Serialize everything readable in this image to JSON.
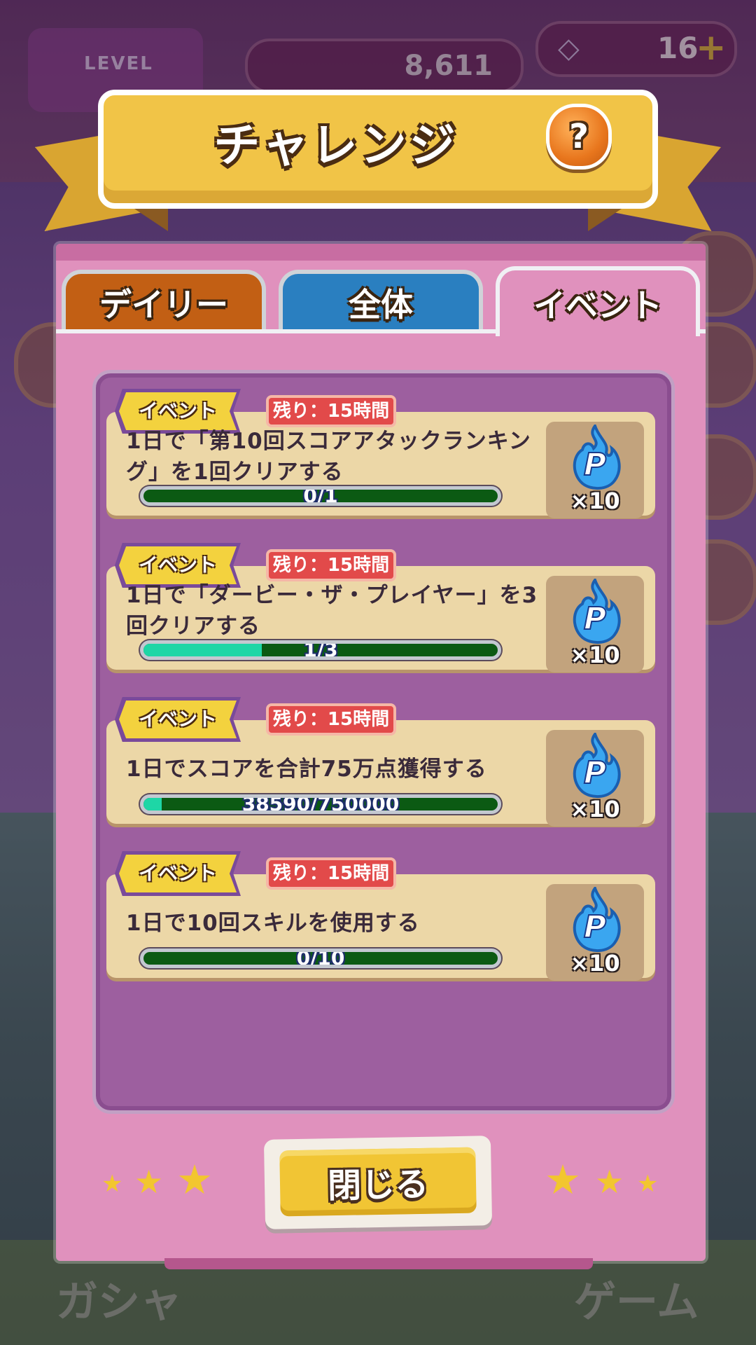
{
  "background": {
    "level_label": "LEVEL",
    "score": "8,611",
    "gems": "16",
    "bottom_labels": [
      "ガシャ",
      "ゲーム"
    ]
  },
  "banner": {
    "title": "チャレンジ",
    "help_label": "?"
  },
  "tabs": [
    {
      "label": "デイリー",
      "active": false,
      "color": "#c25f14"
    },
    {
      "label": "全体",
      "active": false,
      "color": "#2a7fc0"
    },
    {
      "label": "イベント",
      "active": true,
      "color": "#e091bd"
    }
  ],
  "challenges": [
    {
      "badge": "イベント",
      "time_left": "残り：15時間",
      "title": "1日で「第10回スコアアタックランキング」を1回クリアする",
      "progress_text": "0/1",
      "progress_fraction": 0.0,
      "reward_icon": "p-flame-icon",
      "reward_count": "×10"
    },
    {
      "badge": "イベント",
      "time_left": "残り：15時間",
      "title": "1日で「ダービー・ザ・プレイヤー」を3回クリアする",
      "progress_text": "1/3",
      "progress_fraction": 0.3333,
      "reward_icon": "p-flame-icon",
      "reward_count": "×10"
    },
    {
      "badge": "イベント",
      "time_left": "残り：15時間",
      "title": "1日でスコアを合計75万点獲得する",
      "progress_text": "38590/750000",
      "progress_fraction": 0.0515,
      "reward_icon": "p-flame-icon",
      "reward_count": "×10"
    },
    {
      "badge": "イベント",
      "time_left": "残り：15時間",
      "title": "1日で10回スキルを使用する",
      "progress_text": "0/10",
      "progress_fraction": 0.0,
      "reward_icon": "p-flame-icon",
      "reward_count": "×10"
    }
  ],
  "close_button": {
    "label": "閉じる"
  },
  "colors": {
    "panel": "#e091bd",
    "card": "#ecd7a7",
    "progress_fill": "#1ed6a6",
    "progress_track": "#0b5a13",
    "time_badge": "#e24a4a",
    "event_badge": "#f3d23e",
    "close_button": "#f1c534"
  }
}
